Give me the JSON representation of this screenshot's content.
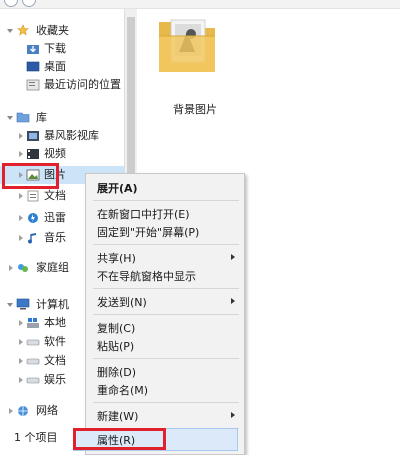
{
  "sidebar": {
    "favorites": "收藏夹",
    "downloads": "下载",
    "desktop": "桌面",
    "recent": "最近访问的位置",
    "libraries": "库",
    "lib_storm": "暴风影视库",
    "lib_video": "视频",
    "lib_pictures": "图片",
    "lib_docs": "文档",
    "lib_thunder": "迅雷",
    "lib_music": "音乐",
    "homegroup": "家庭组",
    "computer": "计算机",
    "drive_local": "本地",
    "drive_soft": "软件",
    "drive_docs": "文档",
    "drive_ent": "娱乐",
    "network": "网络"
  },
  "status": {
    "items": "1 个项目"
  },
  "content": {
    "folder_label": "背景图片"
  },
  "menu": {
    "expand": "展开(A)",
    "open_new_window": "在新窗口中打开(E)",
    "pin_start": "固定到\"开始\"屏幕(P)",
    "share": "共享(H)",
    "hide_nav": "不在导航窗格中显示",
    "send_to": "发送到(N)",
    "copy": "复制(C)",
    "paste": "粘贴(P)",
    "delete": "删除(D)",
    "rename": "重命名(M)",
    "new": "新建(W)",
    "properties": "属性(R)"
  },
  "colors": {
    "highlight_box": "#e0202a",
    "menu_bg": "#f2f2f2",
    "selection": "#dbe9f9"
  }
}
